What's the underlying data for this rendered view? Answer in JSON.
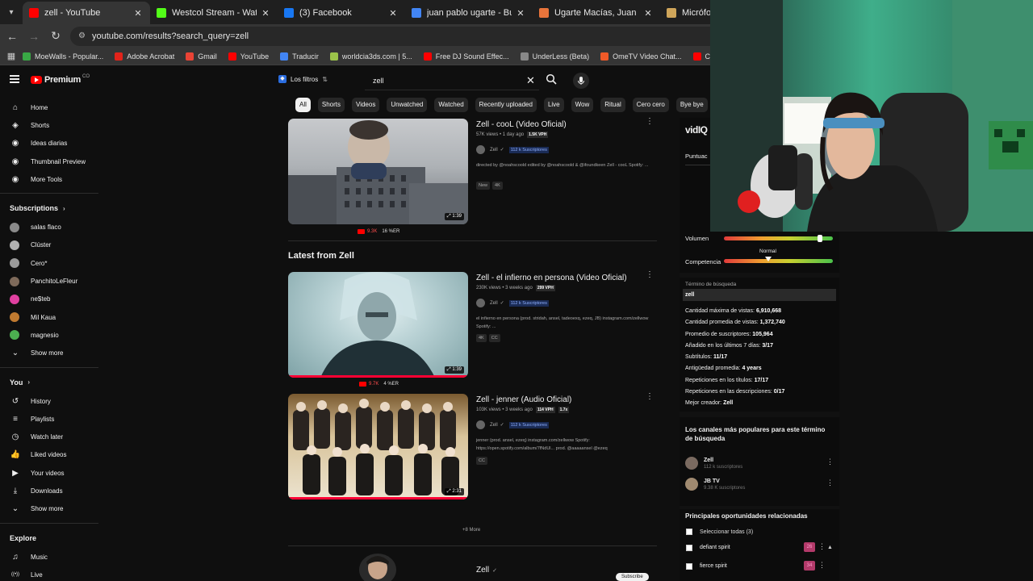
{
  "browser": {
    "tabs": [
      {
        "title": "zell - YouTube",
        "color": "#ff0000",
        "active": true
      },
      {
        "title": "Westcol Stream - Watch Live on",
        "color": "#53fc18",
        "active": false
      },
      {
        "title": "(3) Facebook",
        "color": "#1877f2",
        "active": false
      },
      {
        "title": "juan pablo ugarte - Buscar con",
        "color": "#4285f4",
        "active": false
      },
      {
        "title": "Ugarte Macías, Juan Pablo",
        "color": "#e8743b",
        "active": false
      },
      {
        "title": "Micrófono",
        "color": "#cfa55a",
        "active": false
      }
    ],
    "url": "youtube.com/results?search_query=zell",
    "bookmarks": [
      {
        "label": "MoeWalls - Popular...",
        "color": "#39a845"
      },
      {
        "label": "Adobe Acrobat",
        "color": "#e2231a"
      },
      {
        "label": "Gmail",
        "color": "#ea4335"
      },
      {
        "label": "YouTube",
        "color": "#ff0000"
      },
      {
        "label": "Traducir",
        "color": "#4285f4"
      },
      {
        "label": "worldcia3ds.com | 5...",
        "color": "#9bc34a"
      },
      {
        "label": "Free DJ Sound Effec...",
        "color": "#ff0000"
      },
      {
        "label": "UnderLess (Beta)",
        "color": "#888888"
      },
      {
        "label": "OmeTV Video Chat...",
        "color": "#f05a28"
      },
      {
        "label": "Ch",
        "color": "#ff0000"
      }
    ]
  },
  "yt": {
    "logo": "Premium",
    "logo_sup": "CO",
    "filters": "Los filtros",
    "search_value": "zell",
    "chips": [
      "All",
      "Shorts",
      "Videos",
      "Unwatched",
      "Watched",
      "Recently uploaded",
      "Live",
      "Wow",
      "Ritual",
      "Cero cero",
      "Bye bye",
      "Reaccion"
    ]
  },
  "sidebar": {
    "top": [
      {
        "label": "Home",
        "icon": "home-icon",
        "glyph": "⌂"
      },
      {
        "label": "Shorts",
        "icon": "shorts-icon",
        "glyph": "◈"
      },
      {
        "label": "Ideas diarias",
        "icon": "ideas-icon",
        "glyph": "◉"
      },
      {
        "label": "Thumbnail Preview",
        "icon": "thumbnail-preview-icon",
        "glyph": "◉"
      },
      {
        "label": "More Tools",
        "icon": "more-tools-icon",
        "glyph": "◉"
      }
    ],
    "subscriptions_heading": "Subscriptions",
    "subscriptions": [
      {
        "label": "salas flaco",
        "color": "#8a8a8a"
      },
      {
        "label": "Clúster",
        "color": "#b0b0b0"
      },
      {
        "label": "Cero*",
        "color": "#9a9a9a"
      },
      {
        "label": "PanchitoLeFleur",
        "color": "#7e6a5a"
      },
      {
        "label": "ne$teb",
        "color": "#e040a0"
      },
      {
        "label": "Mil Kaua",
        "color": "#c07a30"
      },
      {
        "label": "magnesio",
        "color": "#4caf50"
      }
    ],
    "show_more": "Show more",
    "you_heading": "You",
    "you": [
      {
        "label": "History",
        "icon": "history-icon",
        "glyph": "↺"
      },
      {
        "label": "Playlists",
        "icon": "playlists-icon",
        "glyph": "≡"
      },
      {
        "label": "Watch later",
        "icon": "watch-later-icon",
        "glyph": "◷"
      },
      {
        "label": "Liked videos",
        "icon": "like-icon",
        "glyph": "👍"
      },
      {
        "label": "Your videos",
        "icon": "your-videos-icon",
        "glyph": "▶"
      },
      {
        "label": "Downloads",
        "icon": "downloads-icon",
        "glyph": "⤓"
      }
    ],
    "show_more_2": "Show more",
    "explore_heading": "Explore",
    "explore": [
      {
        "label": "Music",
        "icon": "music-icon",
        "glyph": "♫"
      },
      {
        "label": "Live",
        "icon": "live-icon",
        "glyph": "((•))"
      }
    ]
  },
  "videos": [
    {
      "title": "Zell - cooL (Video Oficial)",
      "meta": "57K views • 1 day ago",
      "vph": "1.5K VPH",
      "channel": "Zell",
      "subs": "112 k Suscriptores",
      "desc": "directed by @noahscoold edited by @noahscoold & @ifoundkeen Zell - cooL Spotify: ...",
      "tags": [
        "New",
        "4K"
      ],
      "duration": "1:39",
      "stat_red": "9.3K",
      "stat_er": "16 %ER",
      "progress": 0
    },
    {
      "title": "Zell - el infierno en persona (Video Oficial)",
      "meta": "230K views • 3 weeks ago",
      "vph": "299 VPH",
      "channel": "Zell",
      "subs": "112 k Suscriptores",
      "desc": "el infierno en persona (prod. stridah, ansel, tadeoexq, ezeq, JB) instagram.com/zellwow Spotify: ...",
      "tags": [
        "4K",
        "CC"
      ],
      "duration": "1:39",
      "stat_red": "9.7K",
      "stat_er": "4 %ER",
      "progress": 1
    },
    {
      "title": "Zell - jenner (Audio Oficial)",
      "meta": "103K views • 3 weeks ago",
      "vph": "114 VPH",
      "vph2": "1.7x",
      "channel": "Zell",
      "subs": "112 k Suscriptores",
      "desc": "jenner (prod. ansel, ezeq) instagram.com/zellwow Spotify: https://open.spotify.com/album/7fNdUl... prod. @aaaaansel @ezeq",
      "tags": [
        "CC"
      ],
      "duration": "2:31",
      "progress": 1
    }
  ],
  "latest_heading": "Latest from Zell",
  "more_link": "+8 More",
  "bottom_channel": {
    "name": "Zell",
    "subscribe": "Subscribe"
  },
  "vidiq": {
    "logo": "vidIQ",
    "puntuacion": "Puntuac",
    "volumen": "Volumen",
    "competencia": "Competencia",
    "competencia_level": "Normal",
    "volumen_level": 0.88,
    "competencia_marker": 0.41,
    "term_heading": "Término de búsqueda",
    "term": "zell",
    "stats": [
      {
        "k": "Cantidad máxima de vistas:",
        "v": "6,910,668"
      },
      {
        "k": "Cantidad promedia de vistas:",
        "v": "1,372,740"
      },
      {
        "k": "Promedio de suscriptores:",
        "v": "105,964"
      },
      {
        "k": "Añadido en los últimos 7 días:",
        "v": "3/17"
      },
      {
        "k": "Subtítulos:",
        "v": "11/17"
      },
      {
        "k": "Antigüedad promedia:",
        "v": "4 years"
      },
      {
        "k": "Repeticiones en los títulos:",
        "v": "17/17"
      },
      {
        "k": "Repeticiones en las descripciones:",
        "v": "0/17"
      },
      {
        "k": "Mejor creador:",
        "v": "Zell"
      }
    ],
    "popular_heading": "Los canales más populares para este término de búsqueda",
    "channels": [
      {
        "name": "Zell",
        "subs": "112 k suscriptores"
      },
      {
        "name": "JB TV",
        "subs": "9.38 K suscriptores"
      }
    ],
    "opps_heading": "Principales oportunidades relacionadas",
    "select_all": "Seleccionar todas (3)",
    "opps": [
      {
        "label": "defiant spirit",
        "score": "26"
      },
      {
        "label": "fierce spirit",
        "score": "34"
      }
    ]
  }
}
